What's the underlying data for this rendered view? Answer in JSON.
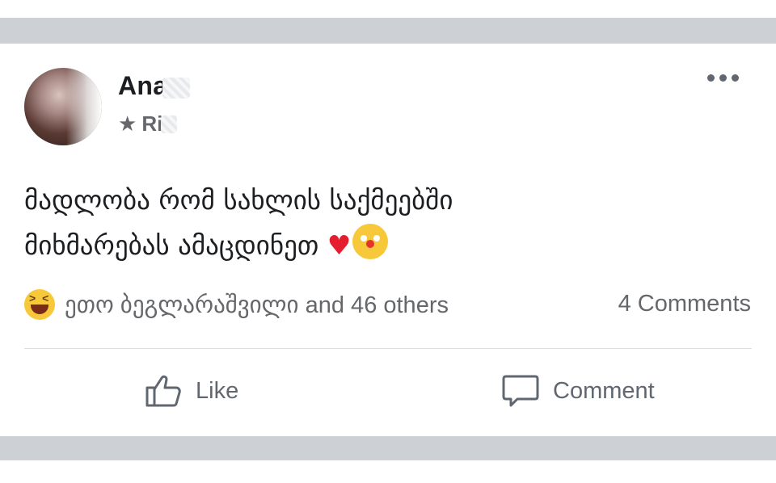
{
  "post": {
    "author_name": "Ana",
    "meta_text": "Ri",
    "text_line1": "მადლობა რომ სახლის საქმეებში",
    "text_line2": "მიხმარებას ამაცდინეთ",
    "heart_emoji": "♥"
  },
  "reactions": {
    "summary": "ეთო ბეგლარაშვილი and 46 others",
    "comments": "4 Comments"
  },
  "actions": {
    "like_label": "Like",
    "comment_label": "Comment"
  },
  "icons": [
    "avatar",
    "star-icon",
    "more-options-icon",
    "heart-emoji",
    "clown-emoji",
    "laugh-reaction-icon",
    "like-icon",
    "comment-icon"
  ],
  "colors": {
    "separator": "#cdd0d4",
    "secondary_text": "#65676b",
    "heart": "#e41e2f"
  }
}
